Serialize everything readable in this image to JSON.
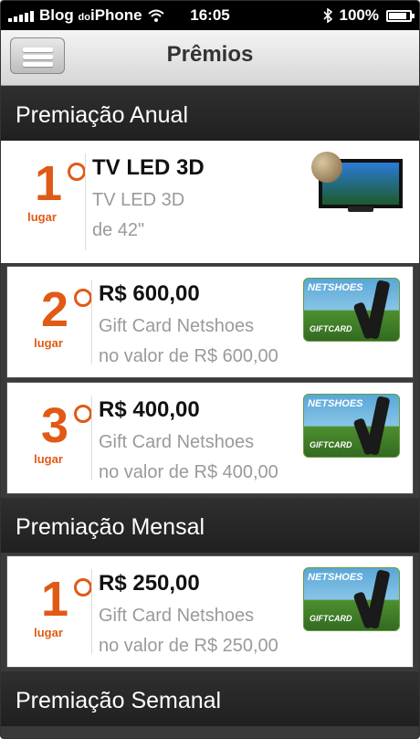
{
  "status_bar": {
    "carrier_prefix": "Blog",
    "carrier_small": "do",
    "carrier_suffix": "iPhone",
    "time": "16:05",
    "battery": "100%"
  },
  "nav": {
    "title": "Prêmios",
    "menu_icon": "hamburger-icon"
  },
  "sections": {
    "annual": {
      "header": "Premiação Anual",
      "items": [
        {
          "place": "1",
          "lugar": "lugar",
          "title": "TV LED 3D",
          "line1": "TV LED 3D",
          "line2": "de 42\""
        },
        {
          "place": "2",
          "lugar": "lugar",
          "title": "R$ 600,00",
          "line1": "Gift Card Netshoes",
          "line2": "no valor de R$ 600,00"
        },
        {
          "place": "3",
          "lugar": "lugar",
          "title": "R$ 400,00",
          "line1": "Gift Card Netshoes",
          "line2": "no valor de R$ 400,00"
        }
      ]
    },
    "monthly": {
      "header": "Premiação Mensal",
      "items": [
        {
          "place": "1",
          "lugar": "lugar",
          "title": "R$ 250,00",
          "line1": "Gift Card Netshoes",
          "line2": "no valor de R$ 250,00"
        }
      ]
    },
    "weekly": {
      "header": "Premiação Semanal"
    }
  },
  "gift_card": {
    "brand": "NETSHOES",
    "label": "GIFTCARD"
  },
  "colors": {
    "accent": "#e05a16",
    "header_bg": "#2a2a2a",
    "muted_text": "#9a9a9a"
  }
}
